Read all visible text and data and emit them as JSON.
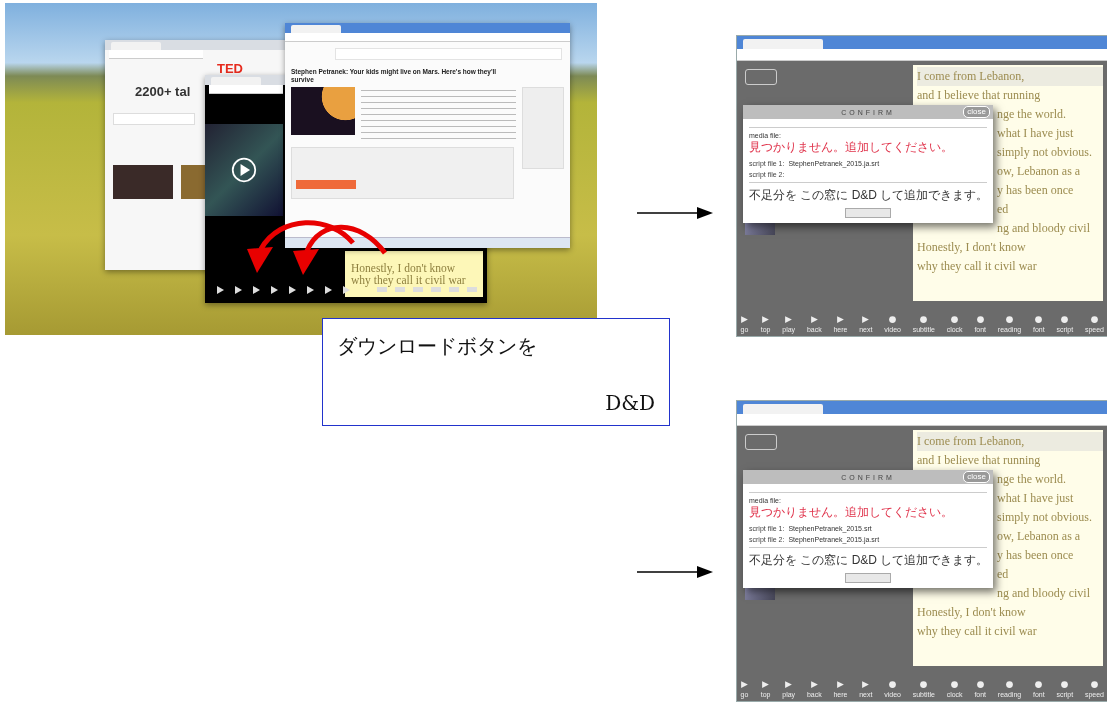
{
  "desktop_screenshot": {
    "talk_list_window": {
      "logo": "TED",
      "heading": "2200+ tal"
    },
    "talk_window": {
      "headline": "Stephen Petranek: Your kids might live on Mars. Here's how they'll survive"
    },
    "player_window": {
      "subtitle_lines": [
        "Honestly, I don't know",
        "why they call it civil war"
      ]
    }
  },
  "callout": {
    "lines": [
      "ダウンロードボタンを",
      "D&D"
    ]
  },
  "result_screenshots": [
    {
      "subtitle_lines": [
        {
          "text": "I come from Lebanon,",
          "covered": false,
          "selected": true
        },
        {
          "text": "and I believe that running",
          "covered": false,
          "selected": false
        },
        {
          "text": "nge the world.",
          "covered": true,
          "selected": false
        },
        {
          "text": "what I have just",
          "covered": true,
          "selected": false
        },
        {
          "text": "simply not obvious.",
          "covered": true,
          "selected": false
        },
        {
          "text": "ow, Lebanon as a",
          "covered": true,
          "selected": false
        },
        {
          "text": "y has been once",
          "covered": true,
          "selected": false
        },
        {
          "text": "ed",
          "covered": true,
          "selected": false
        },
        {
          "text": "ng and bloody civil",
          "covered": true,
          "selected": false
        },
        {
          "text": "Honestly, I don't know",
          "covered": false,
          "selected": false
        },
        {
          "text": "why they call it civil war",
          "covered": false,
          "selected": false
        }
      ],
      "dialog": {
        "title": "CONFIRM",
        "close": "close",
        "rows": [
          {
            "label": "media file:",
            "value": "見つかりません。追加してください。",
            "kind": "error"
          },
          {
            "label": "script file 1:",
            "value": "StephenPetranek_2015.ja.srt",
            "kind": "file"
          },
          {
            "label": "script file 2:",
            "kind": "file"
          }
        ],
        "note": "不足分を この窓に D&D して追加できます。"
      },
      "toolbar_labels": [
        "go",
        "top",
        "play",
        "back",
        "here",
        "next",
        "video",
        "subtitle",
        "clock",
        "font",
        "reading",
        "font",
        "script",
        "speed"
      ]
    },
    {
      "subtitle_lines": [
        {
          "text": "I come from Lebanon,",
          "covered": false,
          "selected": true
        },
        {
          "text": "and I believe that running",
          "covered": false,
          "selected": false
        },
        {
          "text": "nge the world.",
          "covered": true,
          "selected": false
        },
        {
          "text": "what I have just",
          "covered": true,
          "selected": false
        },
        {
          "text": "simply not obvious.",
          "covered": true,
          "selected": false
        },
        {
          "text": "ow, Lebanon as a",
          "covered": true,
          "selected": false
        },
        {
          "text": "y has been once",
          "covered": true,
          "selected": false
        },
        {
          "text": "ed",
          "covered": true,
          "selected": false
        },
        {
          "text": "ng and bloody civil",
          "covered": true,
          "selected": false
        },
        {
          "text": "Honestly, I don't know",
          "covered": false,
          "selected": false
        },
        {
          "text": "why they call it civil war",
          "covered": false,
          "selected": false
        }
      ],
      "dialog": {
        "title": "CONFIRM",
        "close": "close",
        "rows": [
          {
            "label": "media file:",
            "value": "見つかりません。追加してください。",
            "kind": "error"
          },
          {
            "label": "script file 1:",
            "value": "StephenPetranek_2015.srt",
            "kind": "file"
          },
          {
            "label": "script file 2:",
            "value": "StephenPetranek_2015.ja.srt",
            "kind": "file"
          }
        ],
        "note": "不足分を この窓に D&D して追加できます。"
      },
      "toolbar_labels": [
        "go",
        "top",
        "play",
        "back",
        "here",
        "next",
        "video",
        "subtitle",
        "clock",
        "font",
        "reading",
        "font",
        "script",
        "speed"
      ]
    }
  ]
}
